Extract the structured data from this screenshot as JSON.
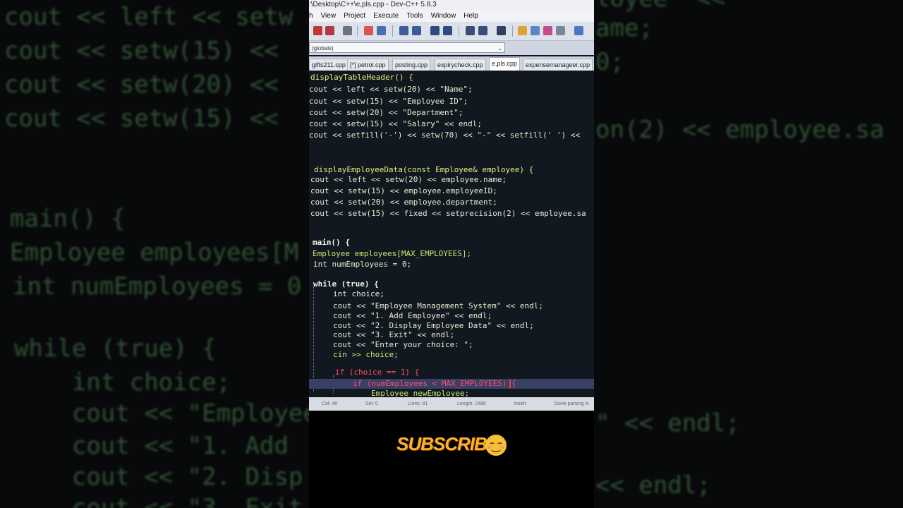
{
  "window": {
    "title": ":\\Desktop\\C++\\e,pls.cpp - Dev-C++ 5.8.3"
  },
  "menu": [
    "h",
    "View",
    "Project",
    "Execute",
    "Tools",
    "Window",
    "Help"
  ],
  "scope": {
    "value": "(globals)"
  },
  "tabs": [
    "gifts211.cpp",
    "[*] petrol.cpp",
    "posting.cpp",
    "expirycheck.cpp",
    "e,pls.cpp",
    "expensemanageer.cpp"
  ],
  "active_tab": "e,pls.cpp",
  "code": [
    "displayTableHeader() {",
    "cout << left << setw(20) << \"Name\";",
    "cout << setw(15) << \"Employee ID\";",
    "cout << setw(20) << \"Department\";",
    "cout << setw(15) << \"Salary\" << endl;",
    "cout << setfill('-') << setw(70) << \"-\" << setfill(' ') <<",
    "displayEmployeeData(const Employee& employee) {",
    "cout << left << setw(20) << employee.name;",
    "cout << setw(15) << employee.employeeID;",
    "cout << setw(20) << employee.department;",
    "cout << setw(15) << fixed << setprecision(2) << employee.sa",
    "main() {",
    "Employee employees[MAX_EMPLOYEES];",
    "int numEmployees = 0;",
    "while (true) {",
    "int choice;",
    "cout << \"Employee Management System\" << endl;",
    "cout << \"1. Add Employee\" << endl;",
    "cout << \"2. Display Employee Data\" << endl;",
    "cout << \"3. Exit\" << endl;",
    "cout << \"Enter your choice: \";",
    "cin >> choice;",
    "if (choice == 1) {",
    "if (numEmployees < MAX_EMPLOYEES) {",
    "Employee newEmployee;"
  ],
  "status": {
    "col": "Col:  48",
    "sel": "Sel:   0",
    "lines": "Lines:  81",
    "length": "Length:  2480",
    "mode": "Insert",
    "msg": "Done parsing in"
  },
  "overlay": {
    "subscribe": "SUBSCRIBE"
  },
  "backdrop_left": [
    "cout << left << setw",
    "cout << setw(15) <<",
    "cout << setw(20) <<",
    "cout << setw(15) <<",
    "main() {",
    "Employee employees[M",
    "int numEmployees = 0",
    "while (true) {",
    "    int choice;",
    "    cout << \"Employee",
    "    cout << \"1. Add",
    "    cout << \"2. Disp",
    "    cout << \"3. Exit"
  ],
  "backdrop_right": [
    "loyee\" <<",
    "ame;",
    "0;",
    "on(2) << employee.sa",
    "\" << endl;",
    "<< endl;"
  ],
  "colors": {
    "keyword": "#f3f6ee",
    "operator": "#ff4d6a",
    "number": "#3a47e8",
    "function": "#e9f07a",
    "subscribe": "#ffb227"
  }
}
